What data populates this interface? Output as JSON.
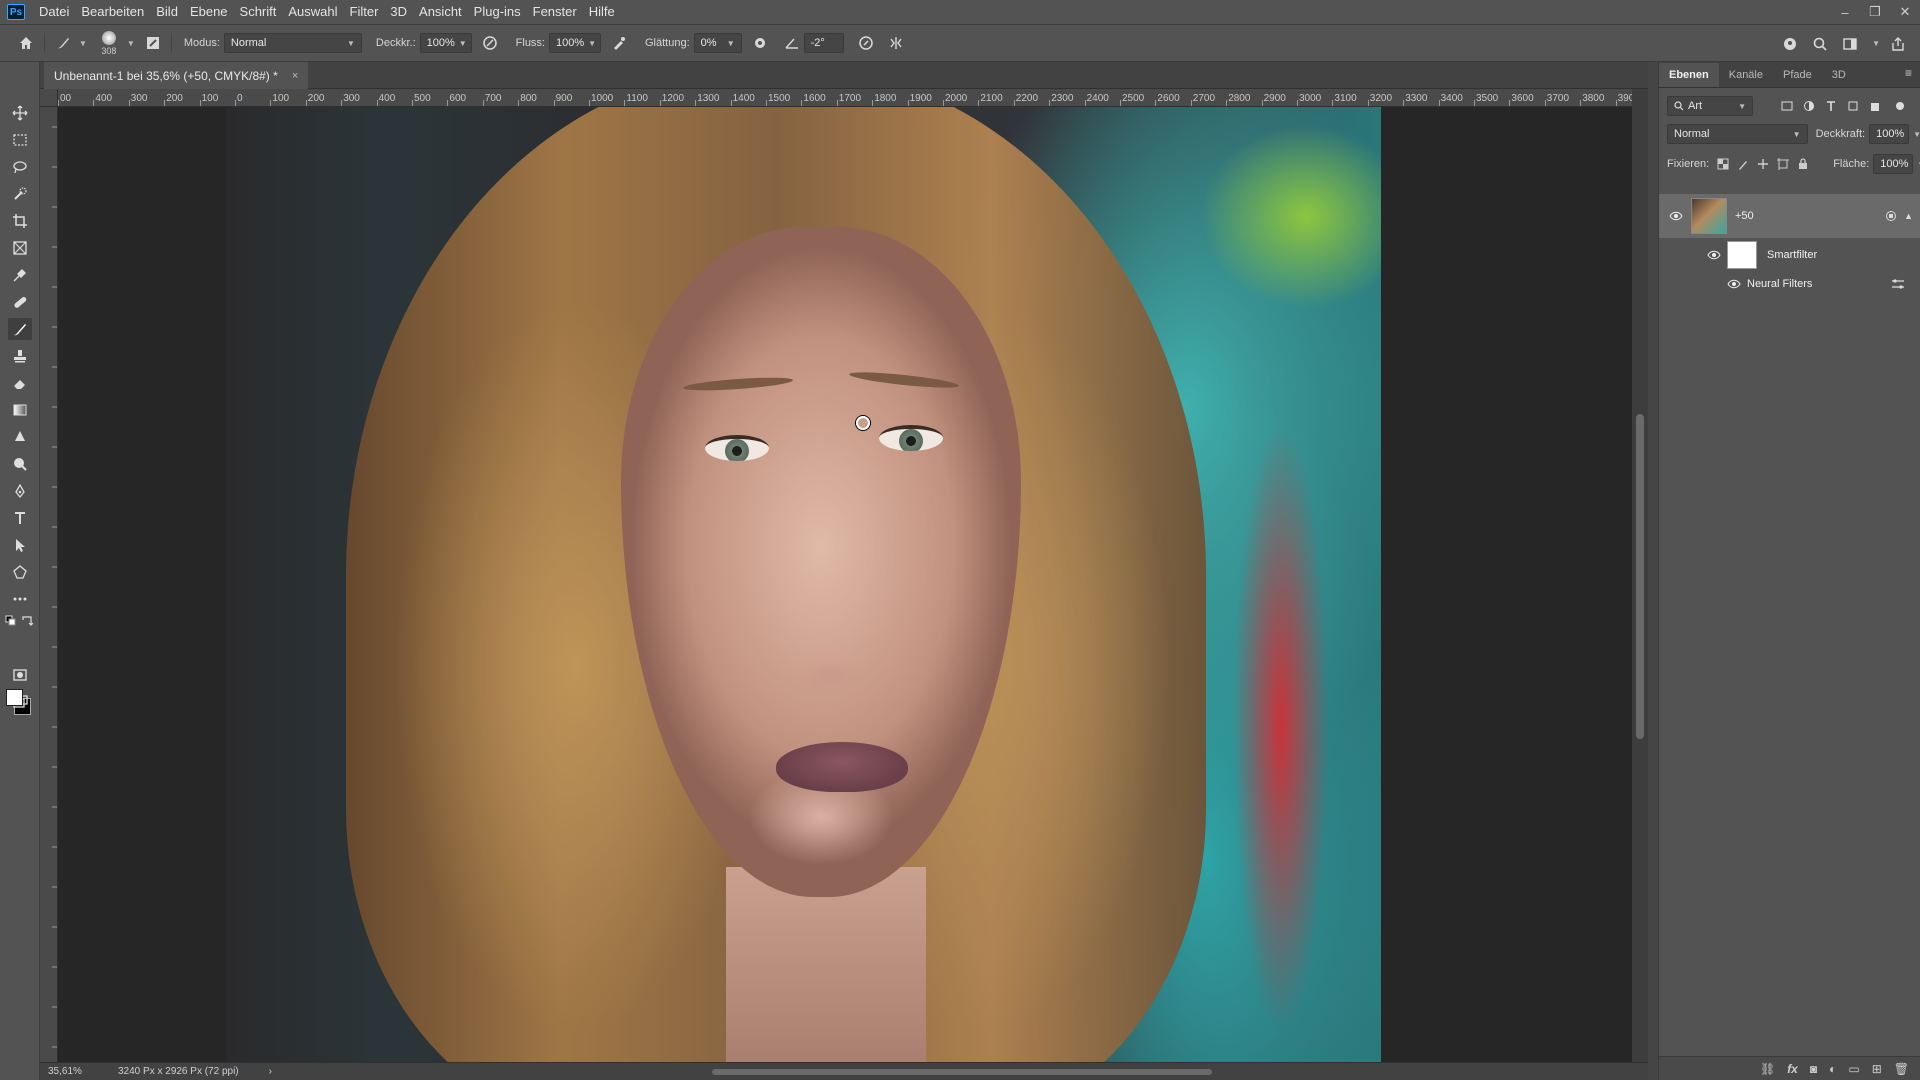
{
  "menu": {
    "logo": "Ps",
    "items": [
      "Datei",
      "Bearbeiten",
      "Bild",
      "Ebene",
      "Schrift",
      "Auswahl",
      "Filter",
      "3D",
      "Ansicht",
      "Plug-ins",
      "Fenster",
      "Hilfe"
    ]
  },
  "window_controls": {
    "minimize": "–",
    "restore": "❐",
    "close": "✕"
  },
  "options": {
    "brush_size": "308",
    "mode_label": "Modus:",
    "mode_value": "Normal",
    "opacity_label": "Deckkr.:",
    "opacity_value": "100%",
    "flow_label": "Fluss:",
    "flow_value": "100%",
    "smoothing_label": "Glättung:",
    "smoothing_value": "0%",
    "angle_value": "-2°"
  },
  "document": {
    "tab_title": "Unbenannt-1 bei 35,6% (+50, CMYK/8#) *",
    "close": "×"
  },
  "ruler": {
    "top_labels": [
      "00",
      "400",
      "300",
      "200",
      "100",
      "0",
      "100",
      "200",
      "300",
      "400",
      "500",
      "600",
      "700",
      "800",
      "900",
      "1000",
      "1100",
      "1200",
      "1300",
      "1400",
      "1500",
      "1600",
      "1700",
      "1800",
      "1900",
      "2000",
      "2100",
      "2200",
      "2300",
      "2400",
      "2500",
      "2600",
      "2700",
      "2800",
      "2900",
      "3000",
      "3100",
      "3200",
      "3300",
      "3400",
      "3500",
      "3600",
      "3700",
      "3800",
      "390"
    ]
  },
  "status": {
    "zoom": "35,61%",
    "doc_info": "3240 Px x 2926 Px (72 ppi)",
    "arrow": "›"
  },
  "layers_panel": {
    "tabs": [
      "Ebenen",
      "Kanäle",
      "Pfade",
      "3D"
    ],
    "active_tab": "Ebenen",
    "filter_label": "Art",
    "blend_mode": "Normal",
    "opacity_label": "Deckkraft:",
    "opacity_value": "100%",
    "lock_label": "Fixieren:",
    "fill_label": "Fläche:",
    "fill_value": "100%",
    "layers": [
      {
        "name": "+50",
        "visible": true,
        "selected": true
      },
      {
        "name": "Smartfilter",
        "visible": true,
        "selected": false
      },
      {
        "name": "Neural Filters",
        "visible": true,
        "selected": false
      }
    ]
  },
  "colors": {
    "foreground": "#ffffff",
    "background": "#000000",
    "ui_base": "#535353",
    "canvas_bg": "#262626"
  },
  "icons": {
    "tools": [
      "move-icon",
      "marquee-icon",
      "lasso-icon",
      "quick-select-icon",
      "crop-icon",
      "frame-icon",
      "eyedropper-icon",
      "healing-icon",
      "brush-icon",
      "stamp-icon",
      "eraser-icon",
      "gradient-icon",
      "blur-icon",
      "dodge-icon",
      "pen-icon",
      "type-icon",
      "path-select-icon",
      "shape-icon",
      "more-icon"
    ]
  }
}
